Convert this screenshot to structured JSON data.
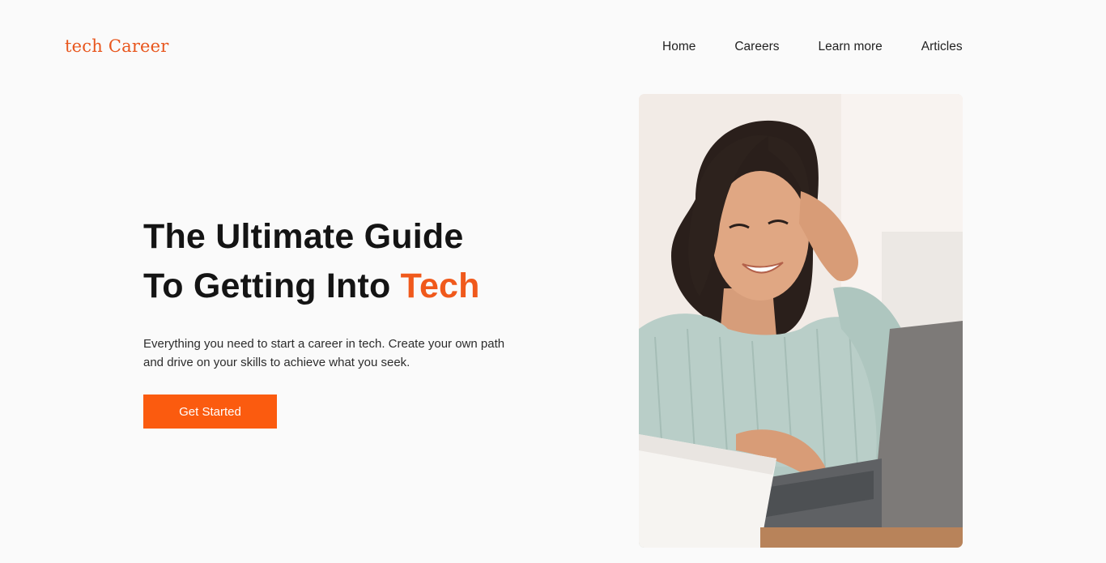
{
  "header": {
    "logo": "tech Career",
    "nav": [
      "Home",
      "Careers",
      "Learn more",
      "Articles"
    ]
  },
  "hero": {
    "title_line1": "The Ultimate Guide",
    "title_line2_prefix": "To Getting Into ",
    "title_line2_accent": "Tech",
    "description": "Everything you need to start a career in tech. Create your own path and drive on your skills to achieve what you seek.",
    "cta_label": "Get Started"
  },
  "colors": {
    "accent": "#f0591b",
    "cta_bg": "#fb5b0f",
    "background": "#fafafa",
    "text": "#141414"
  }
}
